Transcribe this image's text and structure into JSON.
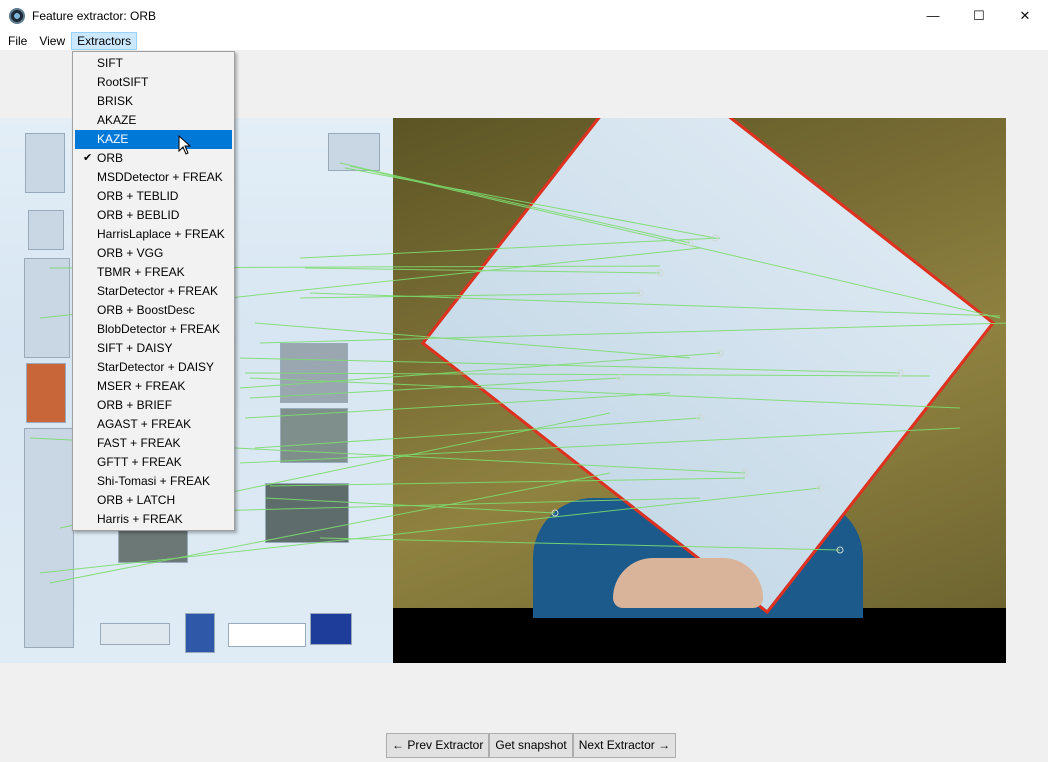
{
  "window": {
    "title": "Feature extractor: ORB",
    "minimize": "—",
    "maximize": "☐",
    "close": "✕"
  },
  "menubar": {
    "file": "File",
    "view": "View",
    "extractors": "Extractors"
  },
  "dropdown": {
    "selected": "ORB",
    "highlighted": "KAZE",
    "items": [
      "SIFT",
      "RootSIFT",
      "BRISK",
      "AKAZE",
      "KAZE",
      "ORB",
      "MSDDetector + FREAK",
      "ORB + TEBLID",
      "ORB + BEBLID",
      "HarrisLaplace + FREAK",
      "ORB + VGG",
      "TBMR + FREAK",
      "StarDetector + FREAK",
      "ORB + BoostDesc",
      "BlobDetector + FREAK",
      "SIFT + DAISY",
      "StarDetector + DAISY",
      "MSER + FREAK",
      "ORB + BRIEF",
      "AGAST + FREAK",
      "FAST + FREAK",
      "GFTT + FREAK",
      "Shi-Tomasi + FREAK",
      "ORB + LATCH",
      "Harris + FREAK"
    ]
  },
  "buttons": {
    "prev": "← Prev Extractor",
    "snapshot": "Get snapshot",
    "next": "Next Extractor →"
  },
  "colors": {
    "match_line": "#7ddc6f",
    "highlight": "#0078d7",
    "poster_border": "#e03020"
  }
}
